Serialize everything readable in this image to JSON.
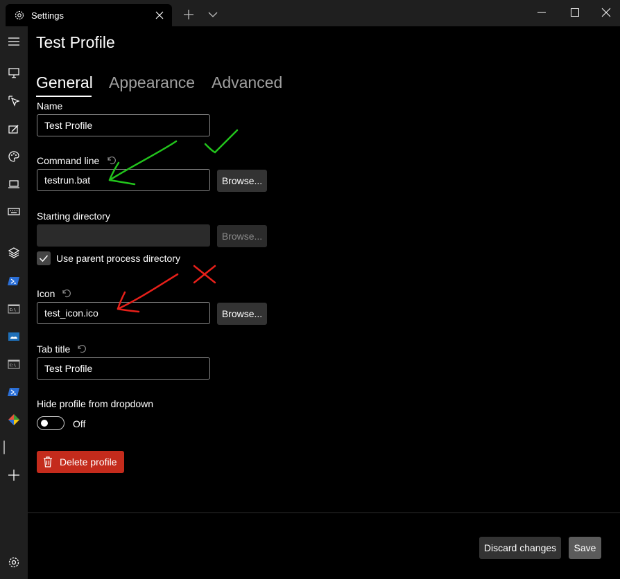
{
  "window": {
    "tab_title": "Settings"
  },
  "page": {
    "title": "Test Profile"
  },
  "pivot": {
    "general": "General",
    "appearance": "Appearance",
    "advanced": "Advanced"
  },
  "fields": {
    "name": {
      "label": "Name",
      "value": "Test Profile"
    },
    "command_line": {
      "label": "Command line",
      "value": "testrun.bat",
      "browse": "Browse..."
    },
    "starting_directory": {
      "label": "Starting directory",
      "value": "",
      "browse": "Browse...",
      "checkbox_label": "Use parent process directory",
      "checked": true
    },
    "icon": {
      "label": "Icon",
      "value": "test_icon.ico",
      "browse": "Browse..."
    },
    "tab_title": {
      "label": "Tab title",
      "value": "Test Profile"
    },
    "hide_profile": {
      "label": "Hide profile from dropdown",
      "state": "Off"
    }
  },
  "actions": {
    "delete": "Delete profile",
    "discard": "Discard changes",
    "save": "Save"
  },
  "colors": {
    "accent_delete": "#c42b1c",
    "annotation_green": "#22c41c",
    "annotation_red": "#e8201a"
  }
}
